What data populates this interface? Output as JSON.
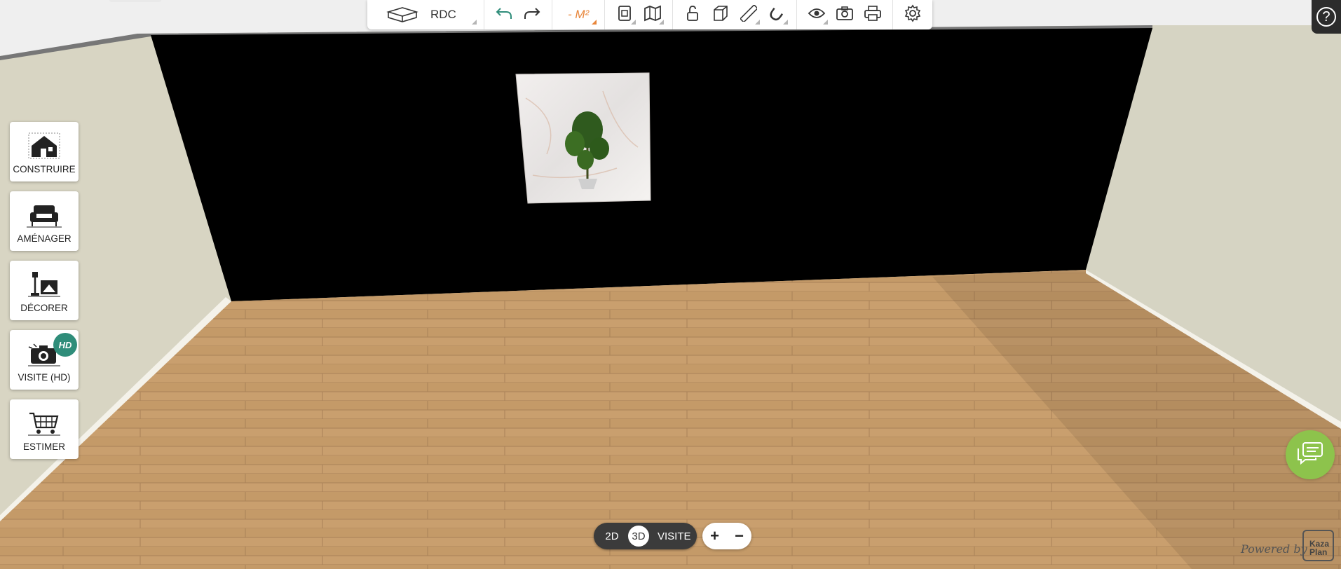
{
  "toolbar": {
    "floor_label": "RDC",
    "surface_label": "- M²",
    "icons": [
      "floor-plan-icon",
      "undo-icon",
      "redo-icon",
      "document-icon",
      "map-icon",
      "unlock-icon",
      "cube-icon",
      "ruler-icon",
      "magnet-icon",
      "eye-icon",
      "camera-icon",
      "printer-icon",
      "gear-icon"
    ]
  },
  "help": {
    "label": "?"
  },
  "sidebar": {
    "items": [
      {
        "label": "CONSTRUIRE",
        "icon": "house-icon"
      },
      {
        "label": "AMÉNAGER",
        "icon": "sofa-icon"
      },
      {
        "label": "DÉCORER",
        "icon": "lamp-frame-icon"
      },
      {
        "label": "VISITE (HD)",
        "icon": "camera-person-icon",
        "badge": "HD"
      },
      {
        "label": "ESTIMER",
        "icon": "cart-icon"
      }
    ]
  },
  "view_toggle": {
    "options": [
      "2D",
      "3D",
      "VISITE"
    ],
    "active": "3D"
  },
  "zoom": {
    "plus": "+",
    "minus": "−"
  },
  "footer": {
    "powered_by": "Powered by",
    "brand_line1": "Kaza",
    "brand_line2": "Plan"
  },
  "colors": {
    "accent_orange": "#e8863b",
    "undo_green": "#2f8d7a",
    "chat_green": "#8dc34c",
    "back_wall": "#000000",
    "floor": "#c99f6e",
    "side_wall": "#d9d6c4"
  }
}
